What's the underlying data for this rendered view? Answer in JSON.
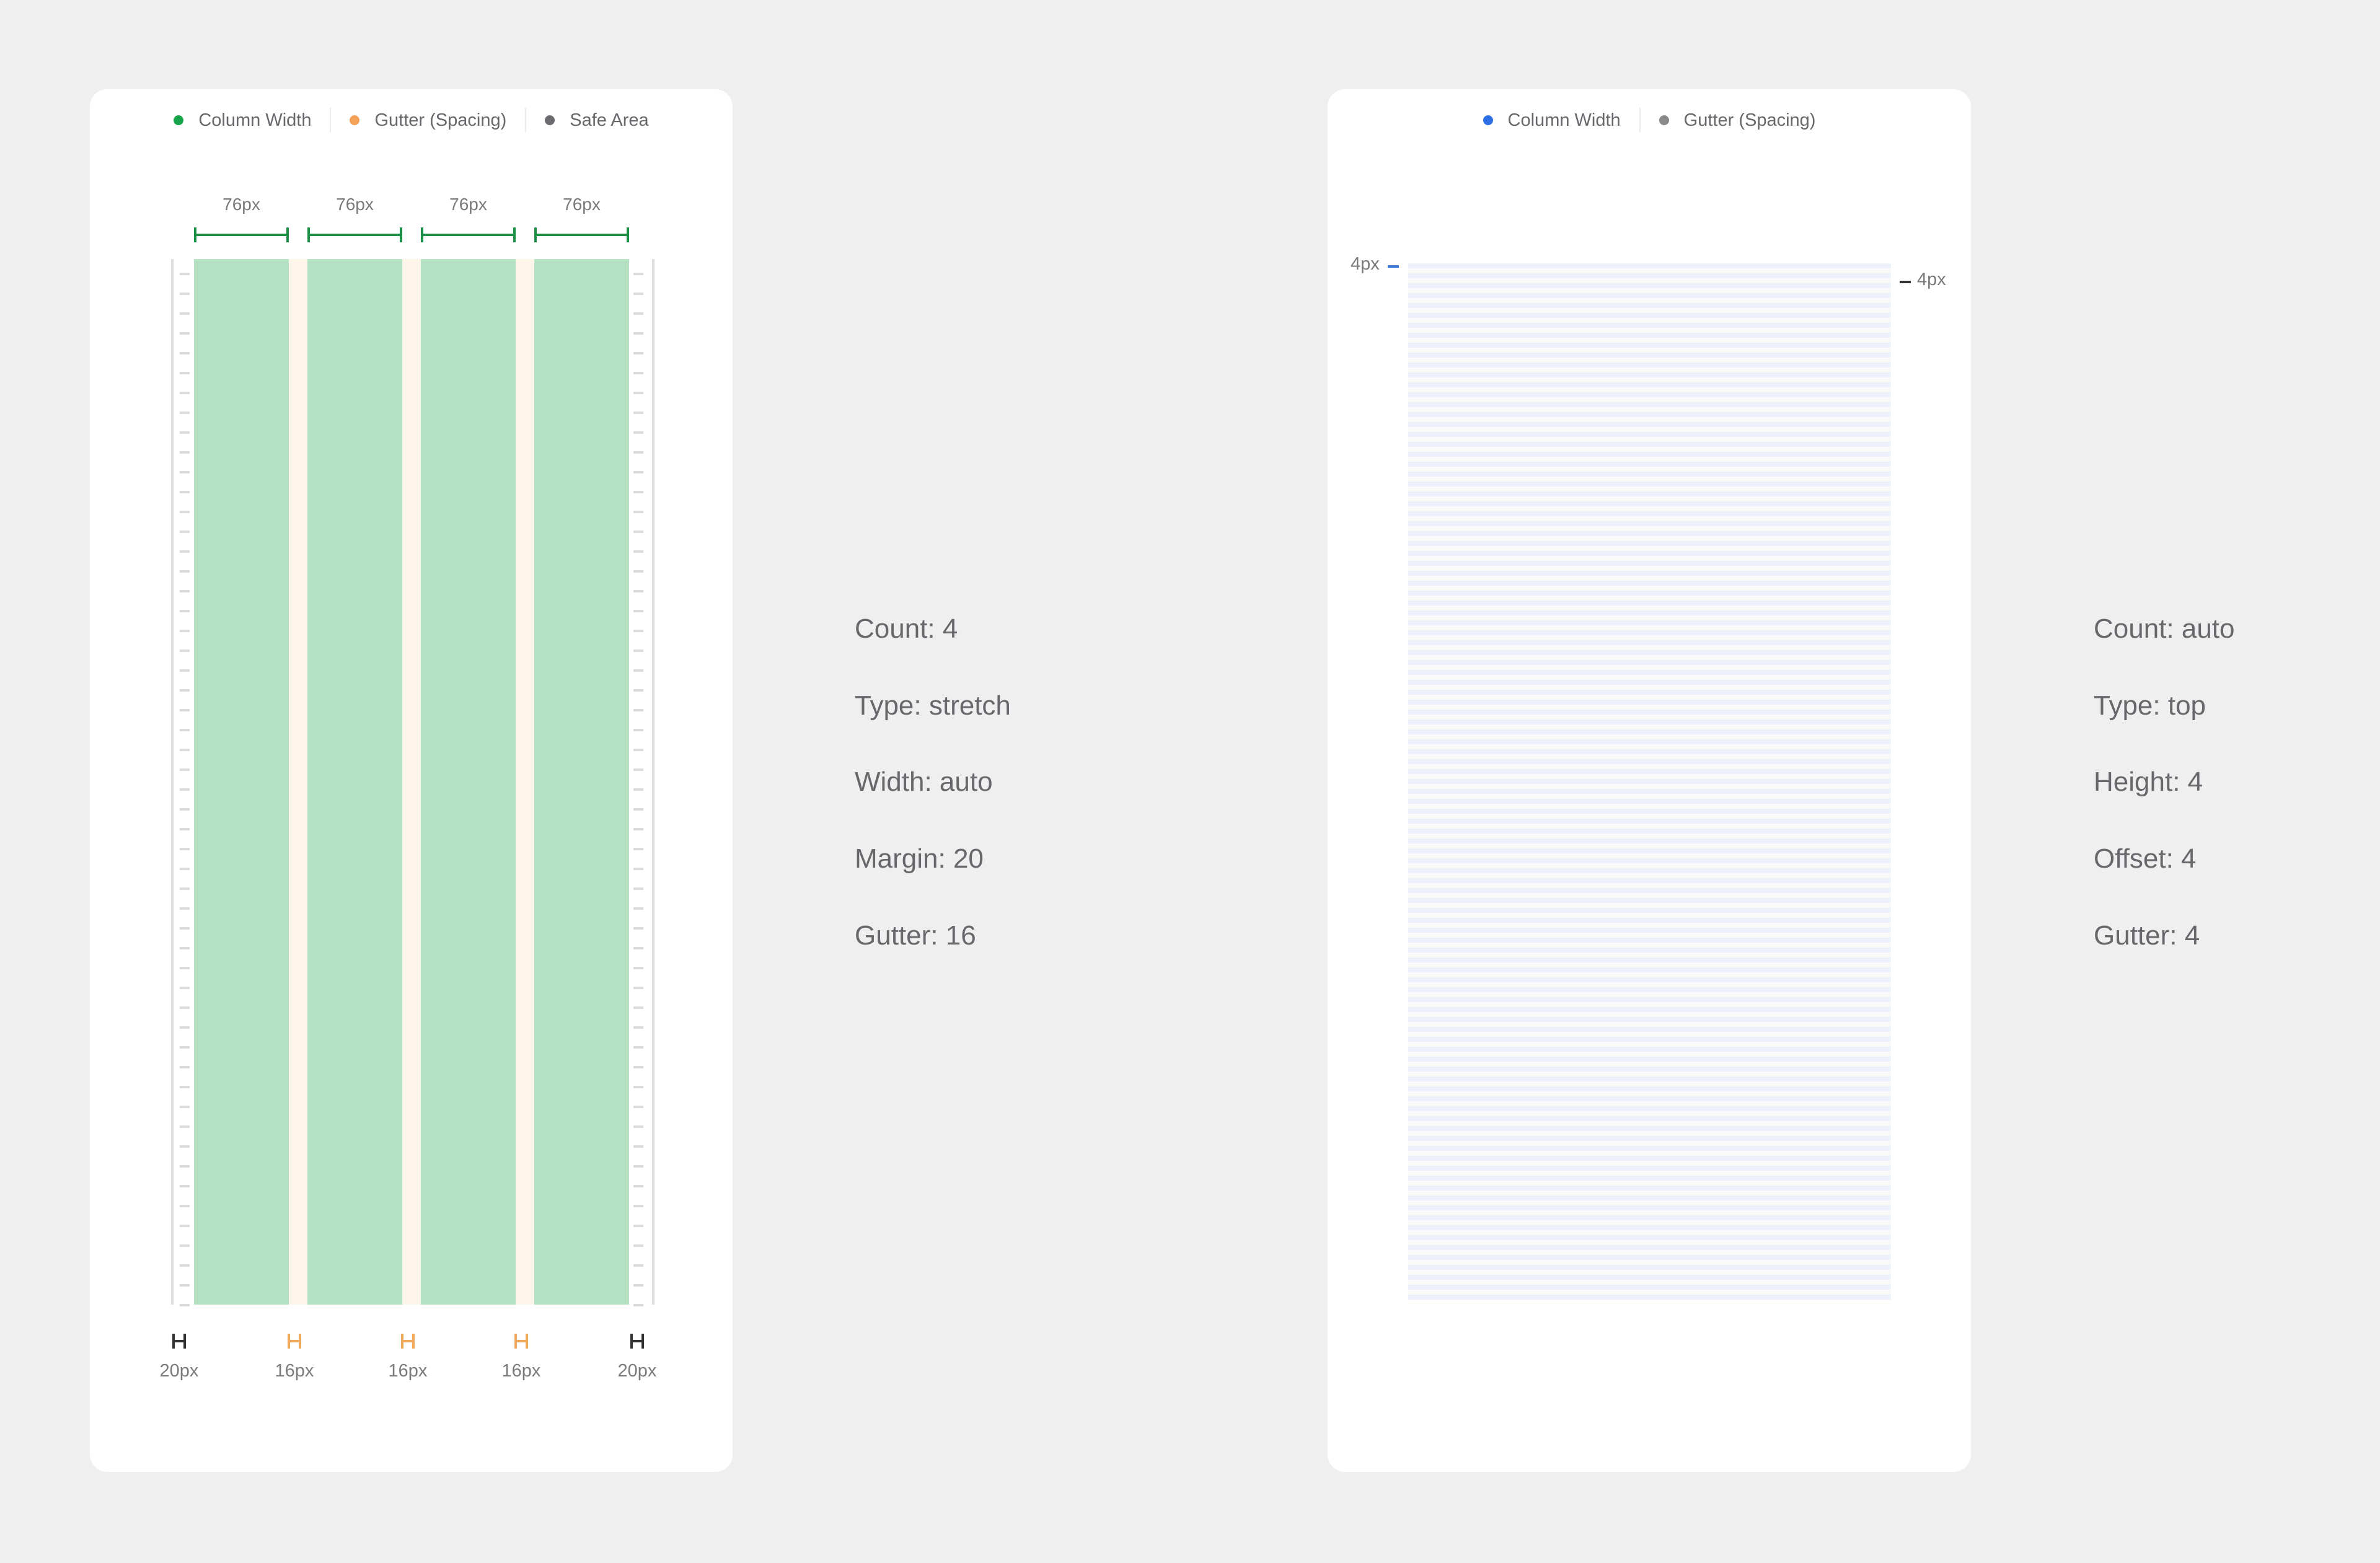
{
  "left_panel": {
    "legend": [
      {
        "label": "Column Width",
        "color": "#16a34a"
      },
      {
        "label": "Gutter (Spacing)",
        "color": "#f4a259"
      },
      {
        "label": "Safe Area",
        "color": "#6b6b70"
      }
    ],
    "column_labels": [
      "76px",
      "76px",
      "76px",
      "76px"
    ],
    "bottom_labels": [
      {
        "label": "20px",
        "kind": "margin"
      },
      {
        "label": "16px",
        "kind": "gutter"
      },
      {
        "label": "16px",
        "kind": "gutter"
      },
      {
        "label": "16px",
        "kind": "gutter"
      },
      {
        "label": "20px",
        "kind": "margin"
      }
    ],
    "colors": {
      "column": "#b5e1c3",
      "gutter": "#fdf5ea",
      "measure": "#1b8f45",
      "gutter_bracket": "#f0a95a",
      "margin_bracket": "#333333"
    }
  },
  "left_spec": {
    "lines": [
      "Count: 4",
      "Type: stretch",
      "Width: auto",
      "Margin: 20",
      "Gutter: 16"
    ]
  },
  "right_panel": {
    "legend": [
      {
        "label": "Column Width",
        "color": "#2f6fe6"
      },
      {
        "label": "Gutter (Spacing)",
        "color": "#8a8a8a"
      }
    ],
    "offset_label": "4px",
    "height_label": "4px",
    "colors": {
      "row": "#edf1fd",
      "gutter": "#fafafa"
    }
  },
  "right_spec": {
    "lines": [
      "Count: auto",
      "Type: top",
      "Height: 4",
      "Offset: 4",
      "Gutter: 4"
    ]
  }
}
